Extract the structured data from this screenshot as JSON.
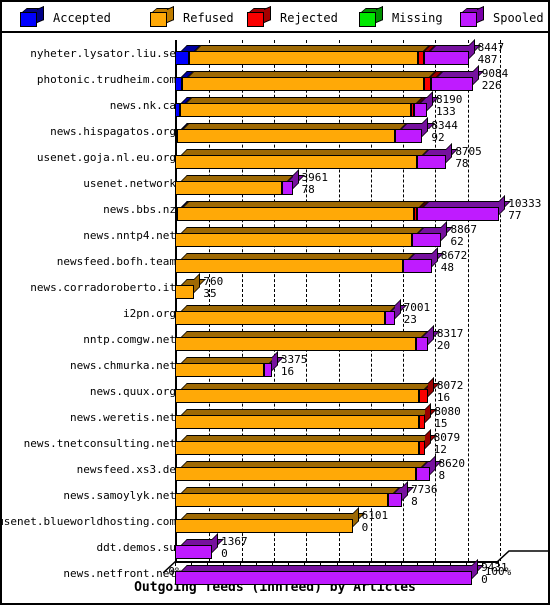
{
  "legend": {
    "items": [
      {
        "label": "Accepted",
        "color": "#0000ff",
        "side": "#000088",
        "icon": "cube-icon"
      },
      {
        "label": "Refused",
        "color": "#ffa907",
        "side": "#c07d00",
        "icon": "cube-icon"
      },
      {
        "label": "Rejected",
        "color": "#fa0000",
        "side": "#a40000",
        "icon": "cube-icon"
      },
      {
        "label": "Missing",
        "color": "#00e800",
        "side": "#009000",
        "icon": "cube-icon"
      },
      {
        "label": "Spooled",
        "color": "#bf1bff",
        "side": "#7a00a8",
        "icon": "cube-icon"
      }
    ]
  },
  "chart_data": {
    "type": "bar",
    "orientation": "horizontal",
    "stacked": true,
    "title": "Outgoing feeds (innfeed) by Articles",
    "xlabel": "Outgoing feeds (innfeed) by Articles",
    "ylabel": "",
    "xlim": [
      0,
      100
    ],
    "xunit": "%",
    "grid": true,
    "legend_position": "top",
    "xticks": [
      "0%",
      "10%",
      "20%",
      "30%",
      "40%",
      "50%",
      "60%",
      "70%",
      "80%",
      "90%",
      "100%"
    ],
    "xtick_values": [
      0,
      10,
      20,
      30,
      40,
      50,
      60,
      70,
      80,
      90,
      100
    ],
    "series": [
      {
        "name": "Accepted",
        "color": "#0000ff"
      },
      {
        "name": "Refused",
        "color": "#ffa907"
      },
      {
        "name": "Rejected",
        "color": "#fa0000"
      },
      {
        "name": "Missing",
        "color": "#00e800"
      },
      {
        "name": "Spooled",
        "color": "#bf1bff"
      }
    ],
    "categories": [
      "nyheter.lysator.liu.se",
      "photonic.trudheim.com",
      "news.nk.ca",
      "news.hispagatos.org",
      "usenet.goja.nl.eu.org",
      "usenet.network",
      "news.bbs.nz",
      "news.nntp4.net",
      "newsfeed.bofh.team",
      "news.corradoroberto.it",
      "i2pn.org",
      "nntp.comgw.net",
      "news.chmurka.net",
      "news.quux.org",
      "news.weretis.net",
      "news.tnetconsulting.net",
      "newsfeed.xs3.de",
      "news.samoylyk.net",
      "usenet.blueworldhosting.com",
      "ddt.demos.su",
      "news.netfront.net"
    ],
    "rows": [
      {
        "category": "nyheter.lysator.liu.se",
        "total": 8447,
        "spooled_label": 487,
        "accepted_pct": 4.2,
        "refused_pct": 71.0,
        "rejected_pct": 1.8,
        "missing_pct": 0,
        "spooled_pct": 13.9
      },
      {
        "category": "photonic.trudheim.com",
        "total": 9084,
        "spooled_label": 226,
        "accepted_pct": 2.2,
        "refused_pct": 75.0,
        "rejected_pct": 2.2,
        "missing_pct": 0,
        "spooled_pct": 12.8
      },
      {
        "category": "news.nk.ca",
        "total": 8190,
        "spooled_label": 133,
        "accepted_pct": 1.6,
        "refused_pct": 71.5,
        "rejected_pct": 0.9,
        "missing_pct": 0,
        "spooled_pct": 4.0
      },
      {
        "category": "news.hispagatos.org",
        "total": 8344,
        "spooled_label": 92,
        "accepted_pct": 0.5,
        "refused_pct": 67.5,
        "rejected_pct": 0,
        "missing_pct": 0,
        "spooled_pct": 8.6
      },
      {
        "category": "usenet.goja.nl.eu.org",
        "total": 8705,
        "spooled_label": 78,
        "accepted_pct": 0,
        "refused_pct": 75.0,
        "rejected_pct": 0,
        "missing_pct": 0,
        "spooled_pct": 9.0
      },
      {
        "category": "usenet.network",
        "total": 3961,
        "spooled_label": 78,
        "accepted_pct": 0,
        "refused_pct": 33.0,
        "rejected_pct": 0,
        "missing_pct": 0,
        "spooled_pct": 3.4
      },
      {
        "category": "news.bbs.nz",
        "total": 10333,
        "spooled_label": 77,
        "accepted_pct": 0.5,
        "refused_pct": 73.5,
        "rejected_pct": 0.9,
        "missing_pct": 0,
        "spooled_pct": 25.5
      },
      {
        "category": "news.nntp4.net",
        "total": 8867,
        "spooled_label": 62,
        "accepted_pct": 0,
        "refused_pct": 73.5,
        "rejected_pct": 0,
        "missing_pct": 0,
        "spooled_pct": 9.0
      },
      {
        "category": "newsfeed.bofh.team",
        "total": 8672,
        "spooled_label": 48,
        "accepted_pct": 0,
        "refused_pct": 70.5,
        "rejected_pct": 0,
        "missing_pct": 0,
        "spooled_pct": 9.0
      },
      {
        "category": "news.corradoroberto.it",
        "total": 760,
        "spooled_label": 35,
        "accepted_pct": 0,
        "refused_pct": 6.0,
        "rejected_pct": 0,
        "missing_pct": 0,
        "spooled_pct": 0
      },
      {
        "category": "i2pn.org",
        "total": 7001,
        "spooled_label": 23,
        "accepted_pct": 0,
        "refused_pct": 65.0,
        "rejected_pct": 0,
        "missing_pct": 0,
        "spooled_pct": 3.0
      },
      {
        "category": "nntp.comgw.net",
        "total": 8317,
        "spooled_label": 20,
        "accepted_pct": 0,
        "refused_pct": 74.5,
        "rejected_pct": 0,
        "missing_pct": 0,
        "spooled_pct": 3.8
      },
      {
        "category": "news.chmurka.net",
        "total": 3375,
        "spooled_label": 16,
        "accepted_pct": 0,
        "refused_pct": 27.5,
        "rejected_pct": 0,
        "missing_pct": 0,
        "spooled_pct": 2.5
      },
      {
        "category": "news.quux.org",
        "total": 8072,
        "spooled_label": 16,
        "accepted_pct": 0,
        "refused_pct": 75.5,
        "rejected_pct": 2.8,
        "missing_pct": 0,
        "spooled_pct": 0
      },
      {
        "category": "news.weretis.net",
        "total": 8080,
        "spooled_label": 15,
        "accepted_pct": 0,
        "refused_pct": 75.5,
        "rejected_pct": 2.0,
        "missing_pct": 0,
        "spooled_pct": 0
      },
      {
        "category": "news.tnetconsulting.net",
        "total": 8079,
        "spooled_label": 12,
        "accepted_pct": 0,
        "refused_pct": 75.5,
        "rejected_pct": 1.8,
        "missing_pct": 0,
        "spooled_pct": 0
      },
      {
        "category": "newsfeed.xs3.de",
        "total": 8620,
        "spooled_label": 8,
        "accepted_pct": 0,
        "refused_pct": 74.5,
        "rejected_pct": 0,
        "missing_pct": 0,
        "spooled_pct": 4.3
      },
      {
        "category": "news.samoylyk.net",
        "total": 7736,
        "spooled_label": 8,
        "accepted_pct": 0,
        "refused_pct": 66.0,
        "rejected_pct": 0,
        "missing_pct": 0,
        "spooled_pct": 4.3
      },
      {
        "category": "usenet.blueworldhosting.com",
        "total": 6101,
        "spooled_label": 0,
        "accepted_pct": 0,
        "refused_pct": 55.0,
        "rejected_pct": 0,
        "missing_pct": 0,
        "spooled_pct": 0
      },
      {
        "category": "ddt.demos.su",
        "total": 1367,
        "spooled_label": 0,
        "accepted_pct": 0,
        "refused_pct": 0,
        "rejected_pct": 0,
        "missing_pct": 0,
        "spooled_pct": 11.5
      },
      {
        "category": "news.netfront.net",
        "total": 9431,
        "spooled_label": 0,
        "accepted_pct": 0,
        "refused_pct": 0,
        "rejected_pct": 0,
        "missing_pct": 0,
        "spooled_pct": 92.0
      }
    ]
  }
}
